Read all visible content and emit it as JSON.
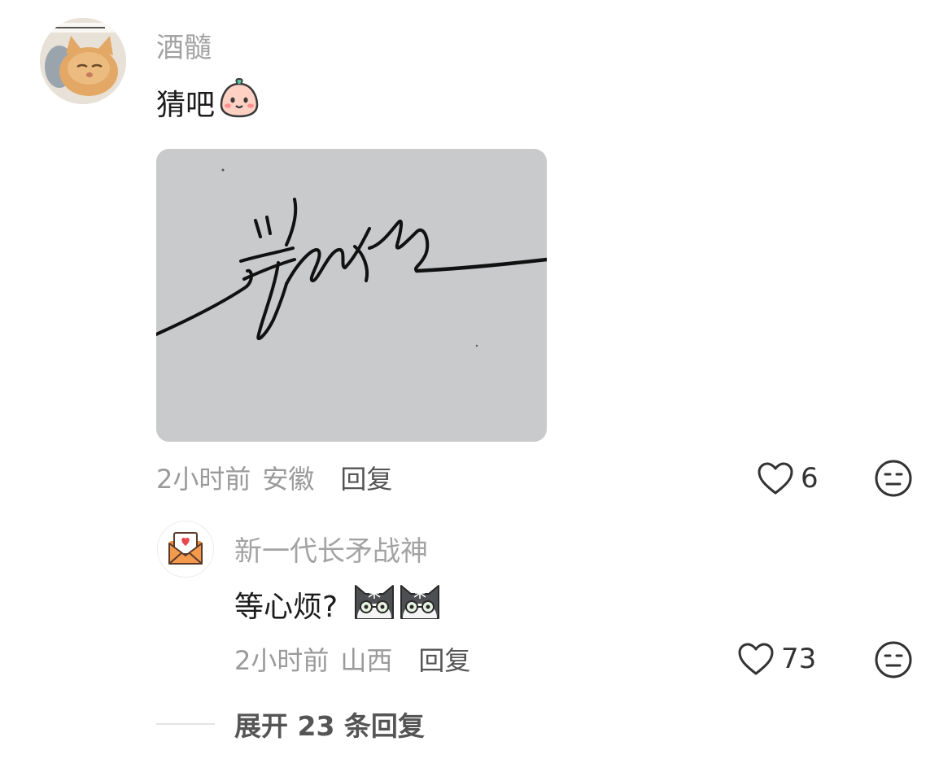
{
  "comment": {
    "username": "酒髓",
    "text": "猜吧",
    "time": "2小时前",
    "location": "安徽",
    "reply_label": "回复",
    "like_count": "6",
    "icons": {
      "avatar": "cat-avatar",
      "text_emoji": "smiling-dumpling-emoji",
      "like": "heart-icon",
      "dislike": "unamused-face-icon"
    }
  },
  "reply": {
    "username": "新一代长矛战神",
    "text": "等心烦?",
    "time": "2小时前",
    "location": "山西",
    "reply_label": "回复",
    "like_count": "73",
    "icons": {
      "avatar": "envelope-heart-avatar",
      "text_emoji": "cat-with-glasses-emoji",
      "like": "heart-icon",
      "dislike": "unamused-face-icon"
    }
  },
  "expand_label": "展开 23 条回复",
  "colors": {
    "username": "#a3a3a3",
    "meta": "#9a9a9a",
    "reply_label": "#555555",
    "attachment_bg": "#c8cacb"
  }
}
